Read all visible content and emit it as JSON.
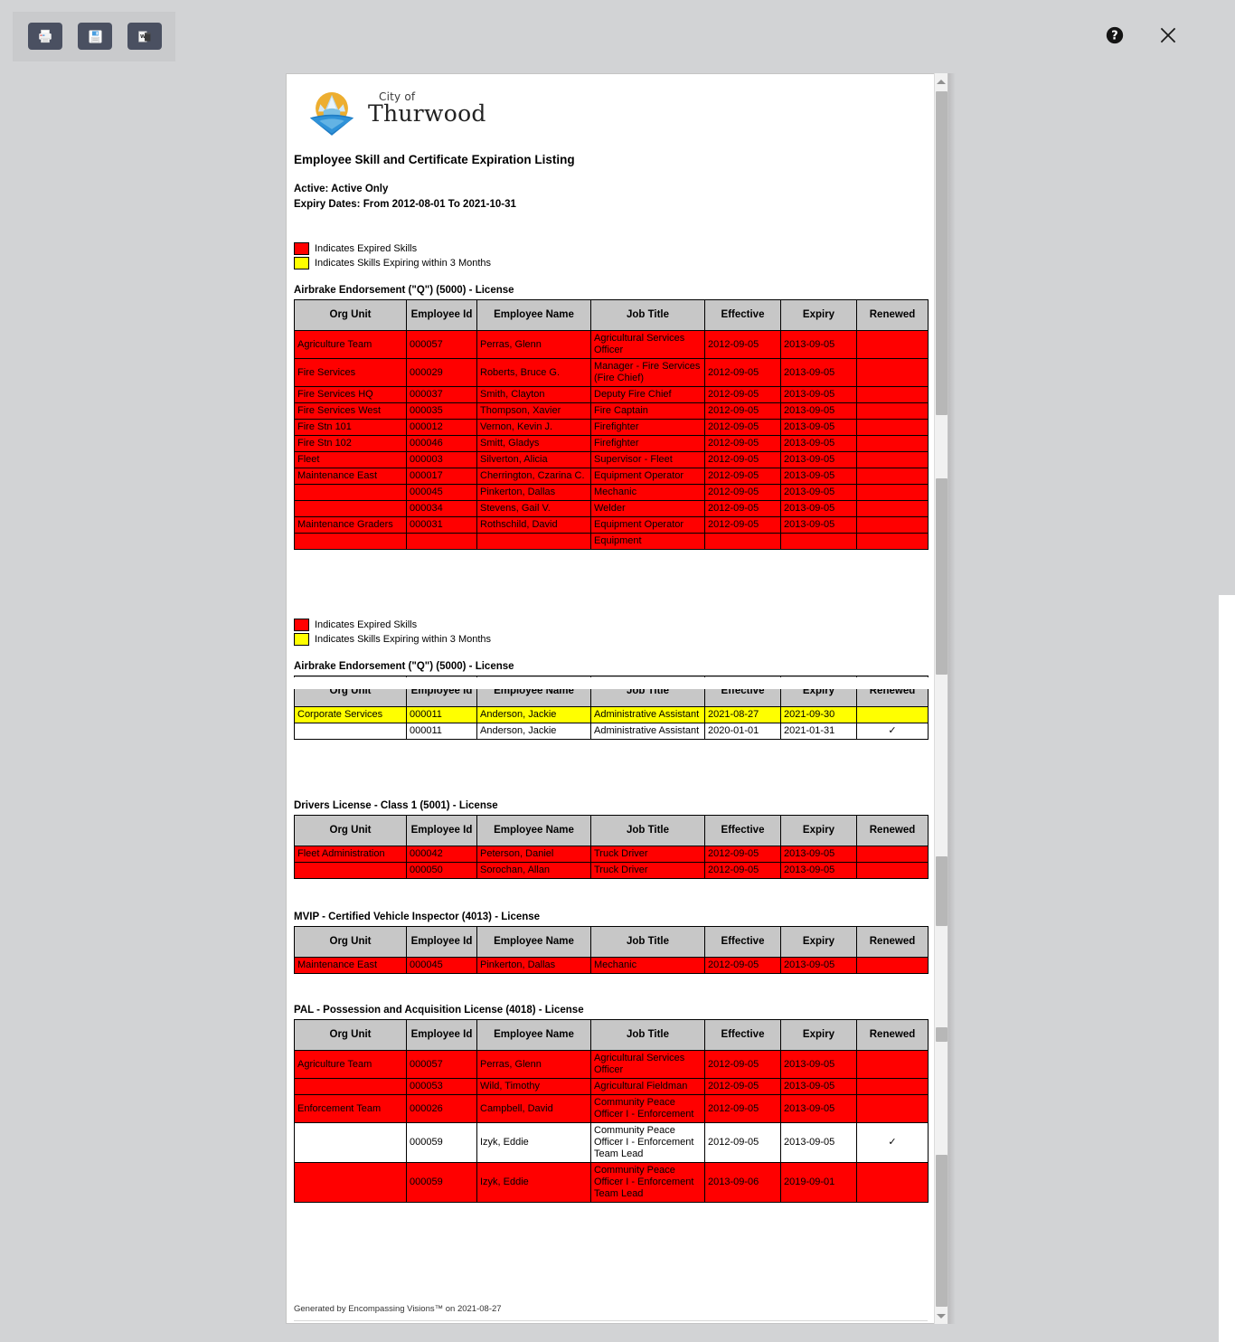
{
  "toolbar": {
    "print_label": "Print",
    "save_label": "Save",
    "word_label": "Export to Word",
    "word_glyph": "W",
    "help_label": "Help",
    "close_label": "Close"
  },
  "logo": {
    "line1": "City of",
    "line2": "Thurwood"
  },
  "report": {
    "title": "Employee Skill and Certificate Expiration Listing",
    "filter_active": "Active: Active Only",
    "filter_dates": "Expiry Dates: From 2012-08-01 To 2021-10-31",
    "footer": "Generated by Encompassing Visions™ on 2021-08-27"
  },
  "legend": {
    "expired_label": "Indicates Expired Skills",
    "expired_color": "#ff0000",
    "warning_label": "Indicates Skills Expiring within 3 Months",
    "warning_color": "#ffff00"
  },
  "columns": [
    "Org Unit",
    "Employee Id",
    "Employee Name",
    "Job Title",
    "Effective",
    "Expiry",
    "Renewed"
  ],
  "sections": [
    {
      "title": "Airbrake Endorsement (\"Q\") (5000) - License",
      "rows": [
        {
          "org": "Agriculture Team",
          "id": "000057",
          "name": "Perras, Glenn",
          "job": "Agricultural Services Officer",
          "effective": "2012-09-05",
          "expiry": "2013-09-05",
          "renewed": "",
          "status": "expired"
        },
        {
          "org": "Fire Services",
          "id": "000029",
          "name": "Roberts, Bruce G.",
          "job": "Manager - Fire Services (Fire Chief)",
          "effective": "2012-09-05",
          "expiry": "2013-09-05",
          "renewed": "",
          "status": "expired"
        },
        {
          "org": "Fire Services HQ",
          "id": "000037",
          "name": "Smith, Clayton",
          "job": "Deputy Fire Chief",
          "effective": "2012-09-05",
          "expiry": "2013-09-05",
          "renewed": "",
          "status": "expired"
        },
        {
          "org": "Fire Services West",
          "id": "000035",
          "name": "Thompson, Xavier",
          "job": "Fire Captain",
          "effective": "2012-09-05",
          "expiry": "2013-09-05",
          "renewed": "",
          "status": "expired"
        },
        {
          "org": "Fire Stn 101",
          "id": "000012",
          "name": "Vernon, Kevin J.",
          "job": "Firefighter",
          "effective": "2012-09-05",
          "expiry": "2013-09-05",
          "renewed": "",
          "status": "expired"
        },
        {
          "org": "Fire Stn 102",
          "id": "000046",
          "name": "Smitt, Gladys",
          "job": "Firefighter",
          "effective": "2012-09-05",
          "expiry": "2013-09-05",
          "renewed": "",
          "status": "expired"
        },
        {
          "org": "Fleet",
          "id": "000003",
          "name": "Silverton, Alicia",
          "job": "Supervisor - Fleet",
          "effective": "2012-09-05",
          "expiry": "2013-09-05",
          "renewed": "",
          "status": "expired"
        },
        {
          "org": "Maintenance East",
          "id": "000017",
          "name": "Cherrington, Czarina C.",
          "job": "Equipment Operator",
          "effective": "2012-09-05",
          "expiry": "2013-09-05",
          "renewed": "",
          "status": "expired"
        },
        {
          "org": "",
          "id": "000045",
          "name": "Pinkerton, Dallas",
          "job": "Mechanic",
          "effective": "2012-09-05",
          "expiry": "2013-09-05",
          "renewed": "",
          "status": "expired"
        },
        {
          "org": "",
          "id": "000034",
          "name": "Stevens, Gail V.",
          "job": "Welder",
          "effective": "2012-09-05",
          "expiry": "2013-09-05",
          "renewed": "",
          "status": "expired"
        },
        {
          "org": "Maintenance Graders",
          "id": "000031",
          "name": "Rothschild, David",
          "job": "Equipment Operator",
          "effective": "2012-09-05",
          "expiry": "2013-09-05",
          "renewed": "",
          "status": "expired"
        },
        {
          "org": "",
          "id": "",
          "name": "",
          "job": "Equipment",
          "effective": "",
          "expiry": "",
          "renewed": "",
          "status": "expired"
        }
      ]
    },
    {
      "title": "Airbrake Endorsement (\"Q\") (5000) - License",
      "rows": [
        {
          "org": "Corporate Services",
          "id": "000011",
          "name": "Anderson, Jackie",
          "job": "Administrative Assistant",
          "effective": "2021-08-27",
          "expiry": "2021-09-30",
          "renewed": "",
          "status": "warning"
        },
        {
          "org": "",
          "id": "000011",
          "name": "Anderson, Jackie",
          "job": "Administrative Assistant",
          "effective": "2020-01-01",
          "expiry": "2021-01-31",
          "renewed": "✓",
          "status": "ok"
        }
      ]
    },
    {
      "title": "Drivers License - Class 1 (5001) - License",
      "rows": [
        {
          "org": "Fleet Administration",
          "id": "000042",
          "name": "Peterson, Daniel",
          "job": "Truck Driver",
          "effective": "2012-09-05",
          "expiry": "2013-09-05",
          "renewed": "",
          "status": "expired"
        },
        {
          "org": "",
          "id": "000050",
          "name": "Sorochan, Allan",
          "job": "Truck Driver",
          "effective": "2012-09-05",
          "expiry": "2013-09-05",
          "renewed": "",
          "status": "expired"
        }
      ]
    },
    {
      "title": "MVIP - Certified Vehicle Inspector (4013) - License",
      "rows": [
        {
          "org": "Maintenance East",
          "id": "000045",
          "name": "Pinkerton, Dallas",
          "job": "Mechanic",
          "effective": "2012-09-05",
          "expiry": "2013-09-05",
          "renewed": "",
          "status": "expired"
        }
      ]
    },
    {
      "title": "PAL - Possession and Acquisition License (4018) - License",
      "rows": [
        {
          "org": "Agriculture Team",
          "id": "000057",
          "name": "Perras, Glenn",
          "job": "Agricultural Services Officer",
          "effective": "2012-09-05",
          "expiry": "2013-09-05",
          "renewed": "",
          "status": "expired"
        },
        {
          "org": "",
          "id": "000053",
          "name": "Wild, Timothy",
          "job": "Agricultural Fieldman",
          "effective": "2012-09-05",
          "expiry": "2013-09-05",
          "renewed": "",
          "status": "expired"
        },
        {
          "org": "Enforcement Team",
          "id": "000026",
          "name": "Campbell, David",
          "job": "Community Peace Officer I - Enforcement",
          "effective": "2012-09-05",
          "expiry": "2013-09-05",
          "renewed": "",
          "status": "expired"
        },
        {
          "org": "",
          "id": "000059",
          "name": "Izyk, Eddie",
          "job": "Community Peace Officer I - Enforcement Team Lead",
          "effective": "2012-09-05",
          "expiry": "2013-09-05",
          "renewed": "✓",
          "status": "ok"
        },
        {
          "org": "",
          "id": "000059",
          "name": "Izyk, Eddie",
          "job": "Community Peace Officer I - Enforcement Team Lead",
          "effective": "2013-09-06",
          "expiry": "2019-09-01",
          "renewed": "",
          "status": "expired"
        }
      ]
    }
  ]
}
